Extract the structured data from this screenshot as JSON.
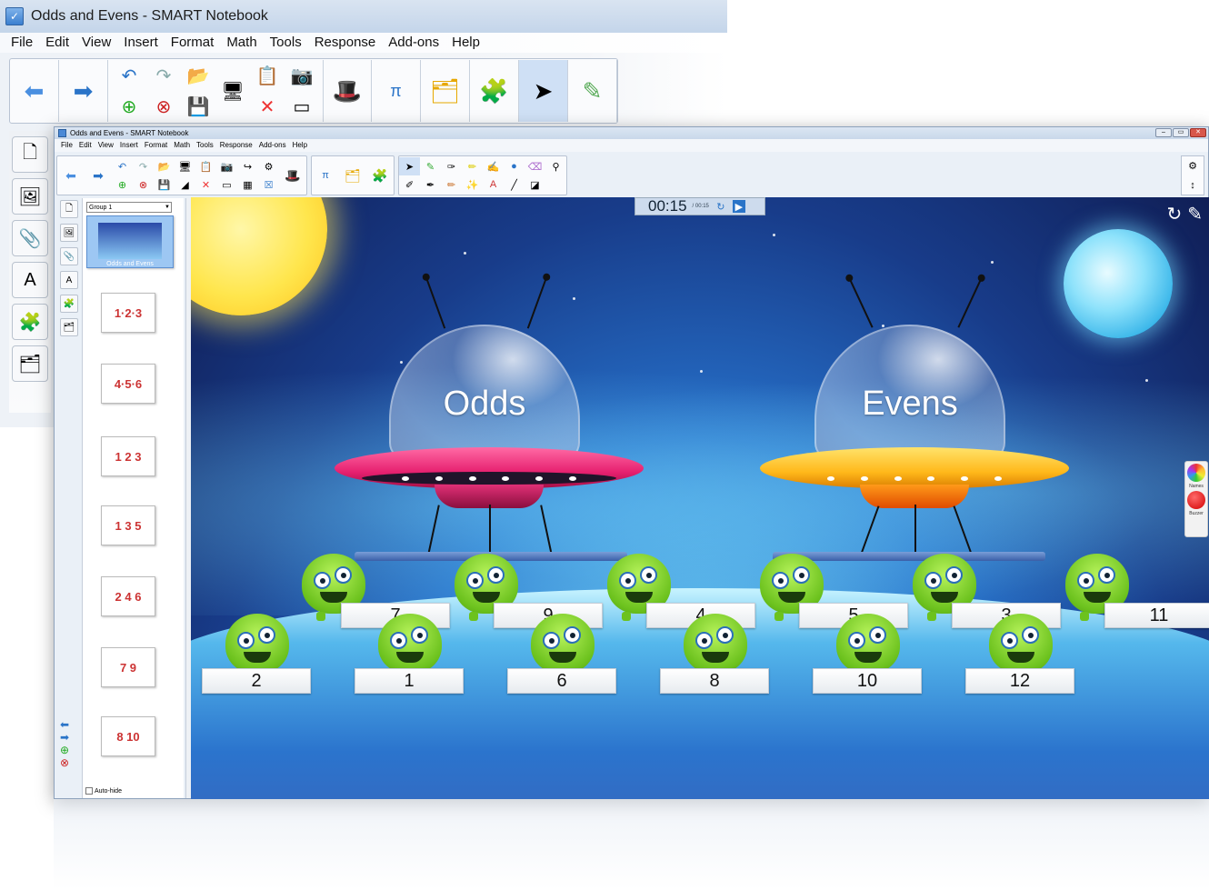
{
  "outer_window": {
    "title": "Odds and Evens - SMART Notebook",
    "menu": [
      "File",
      "Edit",
      "View",
      "Insert",
      "Format",
      "Math",
      "Tools",
      "Response",
      "Add-ons",
      "Help"
    ]
  },
  "inner_window": {
    "title": "Odds and Evens - SMART Notebook",
    "menu": [
      "File",
      "Edit",
      "View",
      "Insert",
      "Format",
      "Math",
      "Tools",
      "Response",
      "Add-ons",
      "Help"
    ]
  },
  "page_sorter": {
    "group_select": "Group 1",
    "first_page_label": "Odds and Evens",
    "thumb_glyphs": [
      "1·2·3",
      "4·5·6",
      "1 2 3",
      "1 3 5",
      "2 4 6",
      "7 9",
      "8 10"
    ],
    "autohide_label": "Auto-hide"
  },
  "timer": {
    "display": "00:15",
    "total": "/ 00:15"
  },
  "ufos": {
    "odds_label": "Odds",
    "evens_label": "Evens"
  },
  "aliens_top": [
    "7",
    "9",
    "4",
    "5",
    "3",
    "11"
  ],
  "aliens_bottom": [
    "2",
    "1",
    "6",
    "8",
    "10",
    "12"
  ],
  "widget": {
    "names": "Names",
    "buzzer": "Buzzer"
  }
}
